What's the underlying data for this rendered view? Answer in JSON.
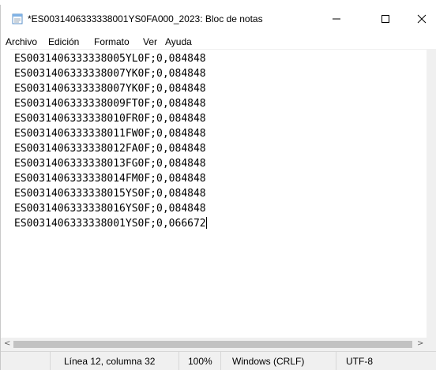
{
  "window": {
    "title": "*ES0031406333338001YS0FA000_2023: Bloc de notas",
    "icon": "notepad-icon",
    "controls": {
      "minimize": "minimize-icon",
      "maximize": "maximize-icon",
      "close": "close-icon"
    }
  },
  "menu": {
    "items": [
      {
        "label": "Archivo"
      },
      {
        "label": "Edición"
      },
      {
        "label": "Formato"
      },
      {
        "label": "Ver"
      },
      {
        "label": "Ayuda"
      }
    ]
  },
  "editor": {
    "lines": [
      "ES0031406333338005YL0F;0,084848",
      "ES0031406333338007YK0F;0,084848",
      "ES0031406333338007YK0F;0,084848",
      "ES0031406333338009FT0F;0,084848",
      "ES0031406333338010FR0F;0,084848",
      "ES0031406333338011FW0F;0,084848",
      "ES0031406333338012FA0F;0,084848",
      "ES0031406333338013FG0F;0,084848",
      "ES0031406333338014FM0F;0,084848",
      "ES0031406333338015YS0F;0,084848",
      "ES0031406333338016YS0F;0,084848",
      "ES0031406333338001YS0F;0,066672"
    ]
  },
  "scrollbar": {
    "left_arrow": "<",
    "right_arrow": ">"
  },
  "status": {
    "position": "Línea 12, columna 32",
    "zoom": "100%",
    "line_ending": "Windows (CRLF)",
    "encoding": "UTF-8"
  },
  "colors": {
    "chrome": "#f0f0f0",
    "text": "#000000",
    "editor_bg": "#ffffff"
  }
}
